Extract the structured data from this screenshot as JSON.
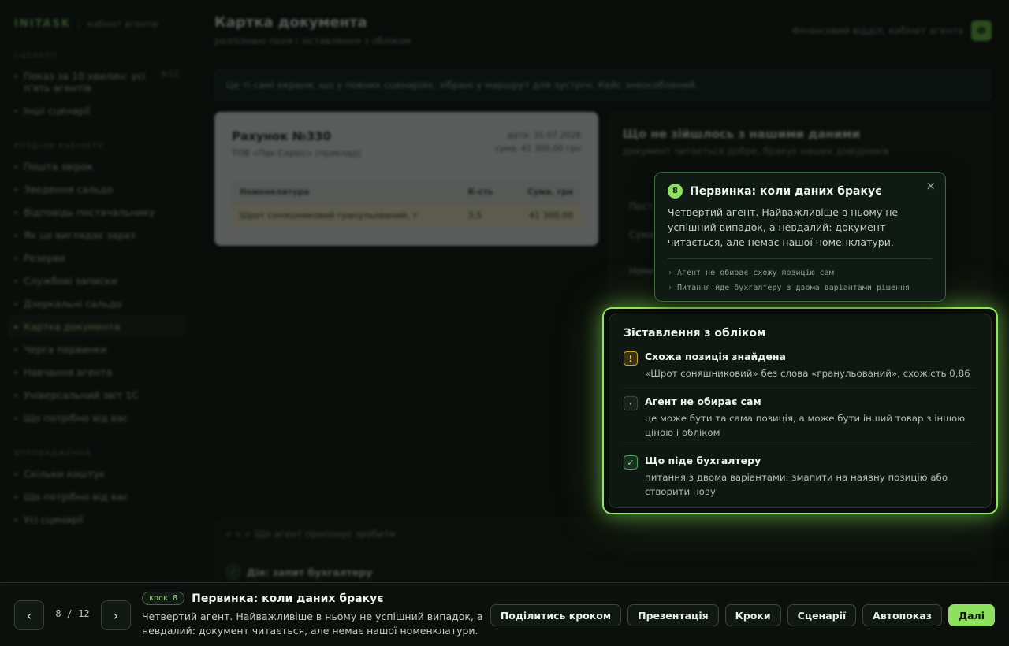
{
  "sidebar": {
    "brand": "INITASK",
    "brand_sub": "кабінет агентів",
    "sections": [
      {
        "title": "СЦЕНАРІЇ",
        "items": [
          {
            "label": "Показ за 10 хвилин: усі п'ять агентів",
            "count": "8/12",
            "active": false
          },
          {
            "label": "Інші сценарії",
            "count": "",
            "active": false
          }
        ]
      },
      {
        "title": "РОЗДІЛИ КАБІНЕТУ",
        "items": [
          {
            "label": "Пошта звірок",
            "count": "",
            "active": false
          },
          {
            "label": "Зведення сальдо",
            "count": "",
            "active": false
          },
          {
            "label": "Відповідь постачальнику",
            "count": "",
            "active": false
          },
          {
            "label": "Як це виглядає зараз",
            "count": "",
            "active": false
          },
          {
            "label": "Резерви",
            "count": "",
            "active": false
          },
          {
            "label": "Службові записки",
            "count": "",
            "active": false
          },
          {
            "label": "Дзеркальні сальдо",
            "count": "",
            "active": false
          },
          {
            "label": "Картка документа",
            "count": "",
            "active": true
          },
          {
            "label": "Черга первинки",
            "count": "",
            "active": false
          },
          {
            "label": "Навчання агента",
            "count": "",
            "active": false
          },
          {
            "label": "Універсальний звіт 1С",
            "count": "",
            "active": false
          },
          {
            "label": "Що потрібно від вас",
            "count": "",
            "active": false
          }
        ]
      },
      {
        "title": "ВПРОВАДЖЕННЯ",
        "items": [
          {
            "label": "Скільки коштує",
            "count": "",
            "active": false
          },
          {
            "label": "Що потрібно від вас",
            "count": "",
            "active": false
          },
          {
            "label": "Усі сценарії",
            "count": "",
            "active": false
          }
        ]
      }
    ]
  },
  "header": {
    "title": "Картка документа",
    "subtitle": "розпізнані поля і зіставлення з обліком",
    "context": "Фінансовий відділ, кабінет агента",
    "avatar": "Ф"
  },
  "notice": "Це ті самі екрани, що у повних сценаріях, зібрані у маршрут для зустрічі. Кейс знеособлений.",
  "invoice": {
    "title": "Рахунок №330",
    "company": "ТОВ «Пак-Сервіс» (приклад)",
    "date": "дата: 31.07.2026",
    "sum": "сума: 41 300,00 грн",
    "columns": [
      "Номенклатура",
      "К-сть",
      "Сума, грн"
    ],
    "rows": [
      [
        "Шрот соняшниковий гранульований, т",
        "3,5",
        "41 300,00"
      ]
    ]
  },
  "mismatch": {
    "title": "Що не зійшлось з нашими даними",
    "subtitle": "документ читається добре, бракує наших довідників",
    "labels": [
      "Пост",
      "Сума",
      "Номе"
    ]
  },
  "spotlight": {
    "title": "Зіставлення з обліком",
    "items": [
      {
        "icon": "!",
        "kind": "warn",
        "title": "Схожа позиція знайдена",
        "desc": "«Шрот соняшниковий» без слова «гранульований», схожість 0,86"
      },
      {
        "icon": "·",
        "kind": "neutral",
        "title": "Агент не обирає сам",
        "desc": "це може бути та сама позиція, а може бути інший товар з іншою ціною і обліком"
      },
      {
        "icon": "✓",
        "kind": "ok",
        "title": "Що піде бухгалтеру",
        "desc": "питання з двома варіантами: змапити на наявну позицію або створити нову"
      }
    ]
  },
  "bottom_card": {
    "header": "Що агент пропонує зробити",
    "action": "Дія: запит бухгалтеру"
  },
  "tooltip": {
    "step": "8",
    "title": "Первинка: коли даних бракує",
    "body": "Четвертий агент. Найважливіше в ньому не успішний випадок, а невдалий: документ читається, але немає нашої номенклатури.",
    "bullets": [
      "Агент не обирає схожу позицію сам",
      "Питання йде бухгалтеру з двома варіантами рішення"
    ],
    "close": "×"
  },
  "footer": {
    "prev": "‹",
    "next": "›",
    "pager": "8 / 12",
    "step_badge": "крок 8",
    "title": "Первинка: коли даних бракує",
    "desc": "Четвертий агент. Найважливіше в ньому не успішний випадок, а невдалий: документ читається, але немає нашої номенклатури.",
    "buttons": [
      "Поділитись кроком",
      "Презентація",
      "Кроки",
      "Сценарії",
      "Автопоказ"
    ],
    "primary": "Далі"
  },
  "colors": {
    "accent": "#8ee05f",
    "warn": "#c9a227",
    "bg": "#0b0f0c"
  }
}
